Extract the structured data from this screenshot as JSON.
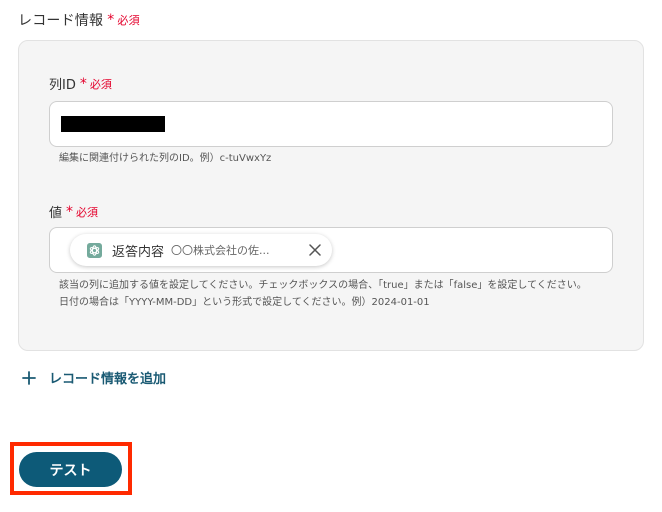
{
  "section": {
    "title": "レコード情報",
    "required_star": "*",
    "required_text": "必須"
  },
  "fields": {
    "column_id": {
      "label": "列ID",
      "required_star": "*",
      "required_text": "必須",
      "help": "編集に関連付けられた列のID。例）c-tuVwxYz"
    },
    "value": {
      "label": "値",
      "required_star": "*",
      "required_text": "必須",
      "chip": {
        "icon": "openai-logo-icon",
        "name": "返答内容",
        "preview": "〇〇株式会社の佐..."
      },
      "help_line1": "該当の列に追加する値を設定してください。チェックボックスの場合、「true」または「false」を設定してください。",
      "help_line2": "日付の場合は「YYYY-MM-DD」という形式で設定してください。例）2024-01-01"
    }
  },
  "add_record": {
    "label": "レコード情報を追加",
    "icon": "plus-icon"
  },
  "test_button": {
    "label": "テスト"
  },
  "colors": {
    "required": "#e4002b",
    "accent": "#1a5a73",
    "button": "#0d5a78",
    "highlight": "#ff2a00"
  }
}
